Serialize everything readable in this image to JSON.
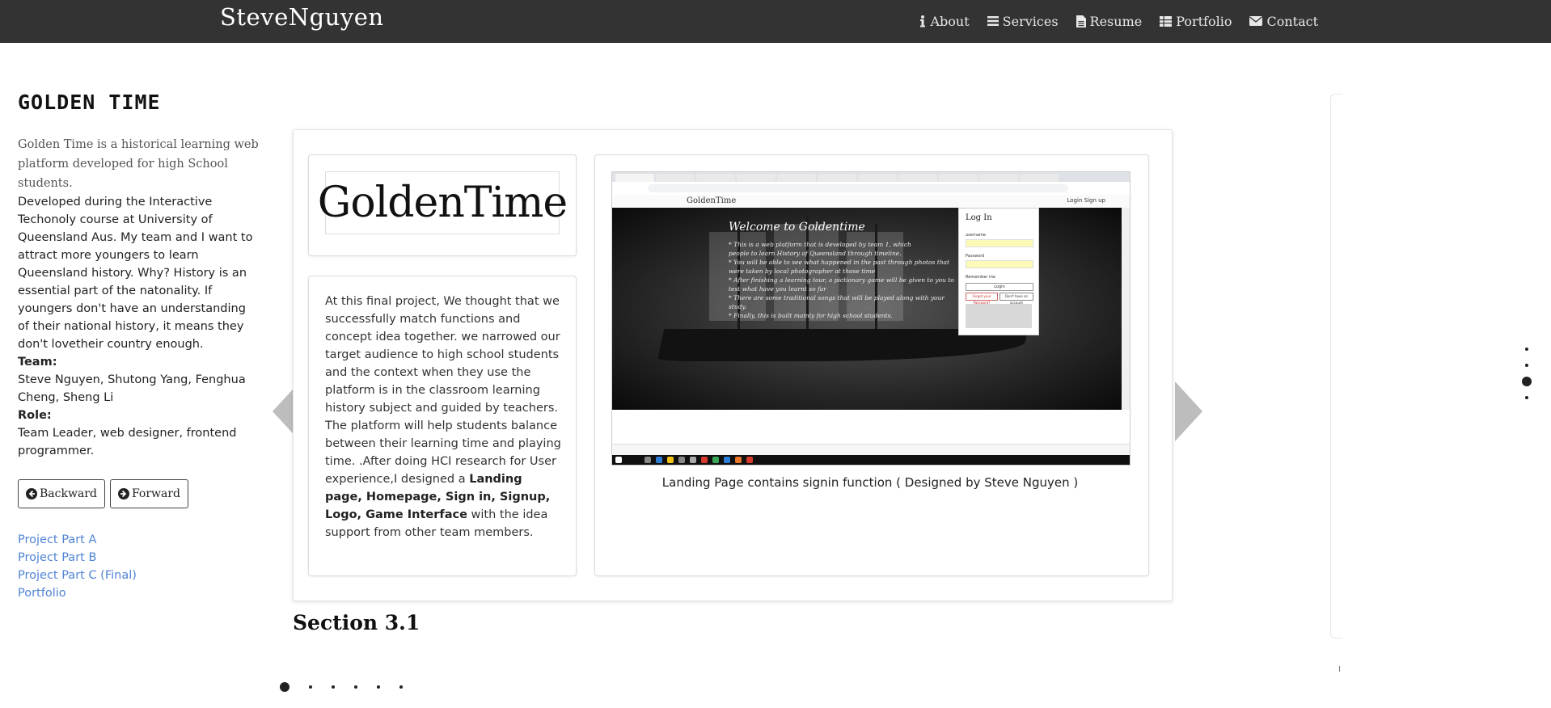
{
  "navbar": {
    "brand": "SteveNguyen",
    "items": [
      {
        "label": "About",
        "icon": "info-icon"
      },
      {
        "label": "Services",
        "icon": "list-icon"
      },
      {
        "label": "Resume",
        "icon": "file-icon"
      },
      {
        "label": "Portfolio",
        "icon": "grid-icon"
      },
      {
        "label": "Contact",
        "icon": "envelope-icon"
      }
    ]
  },
  "sidebar": {
    "title": "GOLDEN TIME",
    "tagline": "Golden Time is a historical learning web platform developed for high School students.",
    "description": "Developed during the Interactive Techonoly course at University of Queensland Aus. My team and I want to attract more youngers to learn Queensland history. Why? History is an essential part of the natonality. If youngers don't have an understanding of their national history, it means they don't lovetheir country enough.",
    "team_label": "Team:",
    "team_value": "Steve Nguyen, Shutong Yang, Fenghua Cheng, Sheng Li",
    "role_label": "Role:",
    "role_value": "Team Leader, web designer, frontend programmer.",
    "buttons": {
      "backward": "Backward",
      "forward": "Forward"
    },
    "links": [
      "Project Part A",
      "Project Part B",
      "Project Part C (Final)",
      "Portfolio"
    ]
  },
  "slide": {
    "logo_text": "GoldenTime",
    "text_part1": "At this final project, We thought that we successfully match functions and concept idea together. we narrowed our target audience to high school students and the context when they use the platform is in the classroom learning history subject and guided by teachers. The platform will help students balance between their learning time and playing time. .After doing HCI research for User experience,I designed a ",
    "text_bold": "Landing page, Homepage, Sign in, Signup, Logo, Game Interface",
    "text_part2": " with the idea support from other team members.",
    "caption": "Landing Page contains signin function ( Designed by Steve Nguyen )",
    "screenshot": {
      "site_logo": "GoldenTime",
      "site_auth": "Login   Sign up",
      "hero_title": "Welcome to Goldentime",
      "hero_lines": [
        "* This is a web platform that is developed by team 1, which",
        "people to learn History of Queensland through timeline.",
        "* You will be able to see what happened in the past through photos that",
        "were taken by local photographer at those time",
        "* After finishing a learning tour, a pictionary game will be given to you to",
        "test what have you learnt so far",
        "* There are some traditional songs that will be played along with your",
        "study.",
        "* Finally, this is built mainly for high school students."
      ],
      "login": {
        "title": "Log In",
        "username_label": "username",
        "password_label": "Password",
        "remember_label": "Remember me",
        "login_button": "Login",
        "forgot_button": "Forgot your Password?",
        "new_button": "Don't have an account"
      }
    }
  },
  "section_label": "Section 3.1",
  "carousel": {
    "active_slide": 1,
    "slide_count": 6
  },
  "section_nav": {
    "active_index": 3,
    "count": 4
  },
  "colors": {
    "navbar": "#333333",
    "link": "#4f84d4",
    "arrow": "#bdbdbd"
  }
}
